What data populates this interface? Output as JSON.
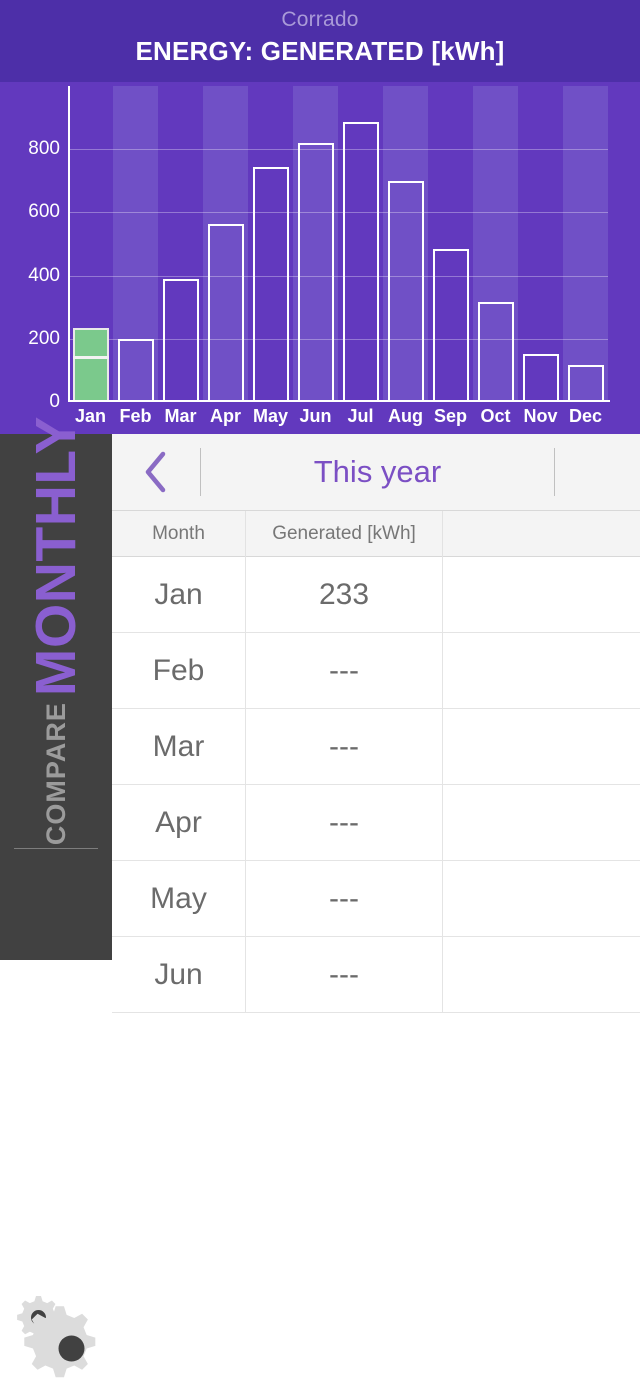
{
  "header": {
    "subtitle": "Corrado",
    "title": "ENERGY: GENERATED [kWh]",
    "bg_color": "#4d2fa8",
    "subtitle_color": "#a99ad8"
  },
  "chart_data": {
    "type": "bar",
    "title": "ENERGY: GENERATED [kWh]",
    "xlabel": "",
    "ylabel": "",
    "categories": [
      "Jan",
      "Feb",
      "Mar",
      "Apr",
      "May",
      "Jun",
      "Jul",
      "Aug",
      "Sep",
      "Oct",
      "Nov",
      "Dec"
    ],
    "values": [
      233,
      200,
      390,
      562,
      745,
      820,
      885,
      700,
      483,
      315,
      152,
      118
    ],
    "ylim": [
      0,
      1000
    ],
    "yticks": [
      0,
      200,
      400,
      600,
      800
    ],
    "ytick_labels": [
      "0",
      "200",
      "400",
      "600",
      "800"
    ],
    "grid": true,
    "legend": "none",
    "selected_category": "Jan",
    "selected_split_value": 130,
    "bar_outline_color": "#ffffff",
    "selected_bar_color": "#7bc98c",
    "plot_bg_color": "#6239be",
    "band_color": "#7050c6"
  },
  "sidebar": {
    "compare_label": "COMPARE",
    "mode_label": "MONTHLY",
    "compare_color": "#9b9b9b",
    "mode_color": "#8a5fd0",
    "bg_color": "#414141",
    "settings_icon": "gears-icon"
  },
  "navbar": {
    "back_icon": "chevron-left-icon",
    "title": "This year",
    "title_color": "#7b4fc4",
    "forward_icon": "chevron-right-icon"
  },
  "table": {
    "columns": [
      "Month",
      "Generated [kWh]",
      ""
    ],
    "rows": [
      {
        "month": "Jan",
        "generated": "233",
        "extra": ""
      },
      {
        "month": "Feb",
        "generated": "---",
        "extra": ""
      },
      {
        "month": "Mar",
        "generated": "---",
        "extra": ""
      },
      {
        "month": "Apr",
        "generated": "---",
        "extra": ""
      },
      {
        "month": "May",
        "generated": "---",
        "extra": ""
      },
      {
        "month": "Jun",
        "generated": "---",
        "extra": ""
      }
    ]
  }
}
